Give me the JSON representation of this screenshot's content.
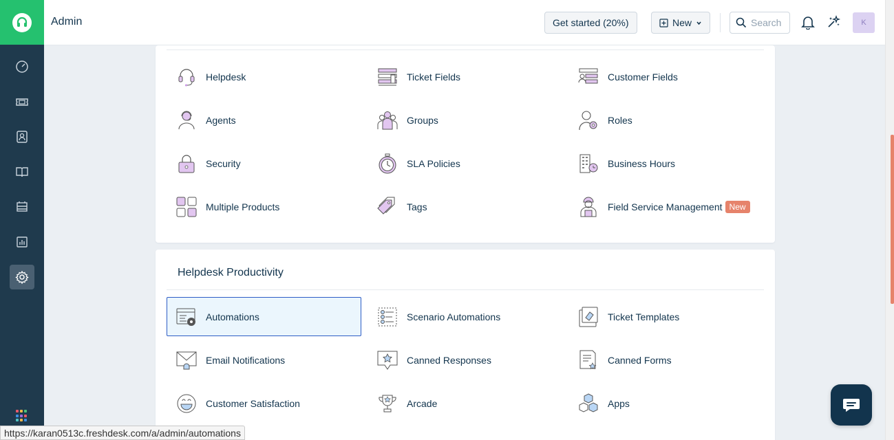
{
  "header": {
    "title": "Admin",
    "get_started": "Get started (20%)",
    "new_label": "New",
    "search_placeholder": "Search",
    "avatar_initial": "K"
  },
  "sidebar": {
    "items": [
      {
        "name": "dashboard-icon"
      },
      {
        "name": "tickets-icon"
      },
      {
        "name": "contacts-icon"
      },
      {
        "name": "solutions-icon"
      },
      {
        "name": "assets-icon"
      },
      {
        "name": "reports-icon"
      },
      {
        "name": "admin-gear-icon",
        "active": true
      }
    ]
  },
  "section1": {
    "items": [
      {
        "label": "Helpdesk",
        "icon": "headset-icon"
      },
      {
        "label": "Ticket Fields",
        "icon": "ticket-fields-icon"
      },
      {
        "label": "Customer Fields",
        "icon": "customer-fields-icon"
      },
      {
        "label": "Agents",
        "icon": "agent-icon"
      },
      {
        "label": "Groups",
        "icon": "groups-icon"
      },
      {
        "label": "Roles",
        "icon": "roles-icon"
      },
      {
        "label": "Security",
        "icon": "lock-icon"
      },
      {
        "label": "SLA Policies",
        "icon": "stopwatch-icon"
      },
      {
        "label": "Business Hours",
        "icon": "building-clock-icon"
      },
      {
        "label": "Multiple Products",
        "icon": "products-grid-icon"
      },
      {
        "label": "Tags",
        "icon": "tags-icon"
      },
      {
        "label": "Field Service Management",
        "icon": "field-technician-icon",
        "badge": "New"
      }
    ]
  },
  "section2": {
    "title": "Helpdesk Productivity",
    "items": [
      {
        "label": "Automations",
        "icon": "automations-icon",
        "selected": true
      },
      {
        "label": "Scenario Automations",
        "icon": "scenario-icon"
      },
      {
        "label": "Ticket Templates",
        "icon": "ticket-template-icon"
      },
      {
        "label": "Email Notifications",
        "icon": "email-bell-icon"
      },
      {
        "label": "Canned Responses",
        "icon": "canned-response-icon"
      },
      {
        "label": "Canned Forms",
        "icon": "canned-forms-icon"
      },
      {
        "label": "Customer Satisfaction",
        "icon": "smiley-icon"
      },
      {
        "label": "Arcade",
        "icon": "trophy-icon"
      },
      {
        "label": "Apps",
        "icon": "apps-cubes-icon"
      }
    ]
  },
  "status_url": "https://karan0513c.freshdesk.com/a/admin/automations",
  "colors": {
    "sidebar": "#1f3a4d",
    "brand_green": "#25c16f",
    "selected_border": "#2c5cc5",
    "badge": "#e6836b"
  }
}
